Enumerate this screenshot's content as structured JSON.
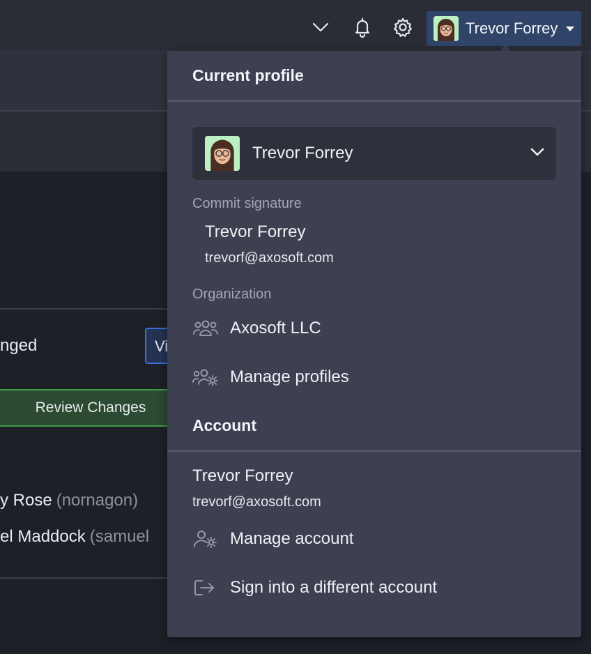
{
  "topbar": {
    "icons": [
      "chevron-down-icon",
      "bell-icon",
      "gear-icon"
    ],
    "profile_name": "Trevor Forrey"
  },
  "background": {
    "changed_text": "nged",
    "view_button_text": "Vi",
    "review_button": "Review Changes",
    "authors": [
      {
        "name": "y Rose",
        "handle": "(nornagon)"
      },
      {
        "name": "el Maddock",
        "handle": "(samuel"
      }
    ]
  },
  "panel": {
    "current_profile_heading": "Current profile",
    "selected_profile": "Trevor Forrey",
    "commit_signature_label": "Commit signature",
    "commit_name": "Trevor Forrey",
    "commit_email": "trevorf@axosoft.com",
    "organization_label": "Organization",
    "organization_name": "Axosoft LLC",
    "manage_profiles": "Manage profiles",
    "account_heading": "Account",
    "account_name": "Trevor Forrey",
    "account_email": "trevorf@axosoft.com",
    "manage_account": "Manage account",
    "sign_into_different": "Sign into a different account"
  },
  "colors": {
    "panel_bg": "#3c4050",
    "profile_button_bg": "#2f4468",
    "review_green": "#3f9b47",
    "accent_blue": "#3b6fd6"
  }
}
